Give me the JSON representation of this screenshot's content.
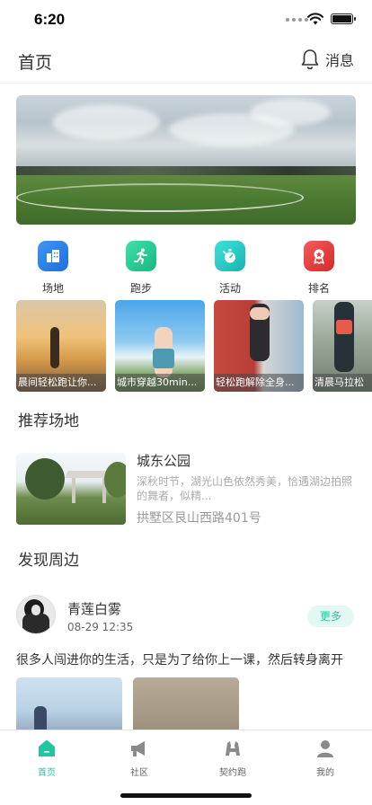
{
  "status_bar": {
    "time": "6:20"
  },
  "header": {
    "title": "首页",
    "message_label": "消息"
  },
  "quick_nav": [
    {
      "label": "场地",
      "icon": "building-icon",
      "color": "#2b7de9"
    },
    {
      "label": "跑步",
      "icon": "runner-icon",
      "color": "#25c796"
    },
    {
      "label": "活动",
      "icon": "stopwatch-icon",
      "color": "#24c6c0"
    },
    {
      "label": "排名",
      "icon": "medal-icon",
      "color": "#e93d3d"
    }
  ],
  "activity_cards": [
    {
      "caption": "晨间轻松跑让你..."
    },
    {
      "caption": "城市穿越30min..."
    },
    {
      "caption": "轻松跑解除全身..."
    },
    {
      "caption": "清晨马拉松"
    }
  ],
  "recommended": {
    "title": "推荐场地",
    "venue": {
      "name": "城东公园",
      "description": "深秋时节，湖光山色依然秀美，恰遇湖边拍照的舞者，似精...",
      "address": "拱墅区艮山西路401号"
    }
  },
  "discover": {
    "title": "发现周边",
    "post": {
      "user": "青莲白雾",
      "time": "08-29 12:35",
      "more_label": "更多",
      "text": "很多人闯进你的生活，只是为了给你上一课，然后转身离开"
    }
  },
  "tab_bar": {
    "active_color": "#22c5a0",
    "items": [
      {
        "label": "首页",
        "icon": "home-icon",
        "active": true
      },
      {
        "label": "社区",
        "icon": "megaphone-icon",
        "active": false
      },
      {
        "label": "契约跑",
        "icon": "handshake-icon",
        "active": false
      },
      {
        "label": "我的",
        "icon": "user-icon",
        "active": false
      }
    ]
  }
}
